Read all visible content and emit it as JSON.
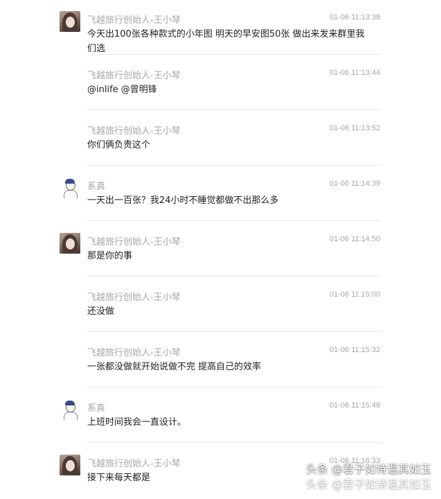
{
  "messages": [
    {
      "sender": "飞越旅行创始人-王小琴",
      "time": "01-06 11:13:38",
      "avatar": "female-photo",
      "text": "今天出100张各种款式的小年图 明天的早安图50张 做出来发来群里我们选",
      "show_avatar": true
    },
    {
      "sender": "飞越旅行创始人-王小琴",
      "time": "01-06 11:13:44",
      "avatar": "female-photo",
      "text": "@inlife @曾明锋",
      "show_avatar": false
    },
    {
      "sender": "飞越旅行创始人-王小琴",
      "time": "01-06 11:13:52",
      "avatar": "female-photo",
      "text": "你们俩负责这个",
      "show_avatar": false
    },
    {
      "sender": "系真",
      "time": "01-06 11:14:39",
      "avatar": "anime-sketch",
      "text": "一天出一百张？我24小时不睡觉都做不出那么多",
      "show_avatar": true
    },
    {
      "sender": "飞越旅行创始人-王小琴",
      "time": "01-06 11:14:50",
      "avatar": "female-photo",
      "text": "那是你的事",
      "show_avatar": true
    },
    {
      "sender": "飞越旅行创始人-王小琴",
      "time": "01-06 11:15:00",
      "avatar": "female-photo",
      "text": "还没做",
      "show_avatar": false
    },
    {
      "sender": "飞越旅行创始人-王小琴",
      "time": "01-06 11:15:32",
      "avatar": "female-photo",
      "text": "一张都没做就开始说做不完 提高自己的效率",
      "show_avatar": false
    },
    {
      "sender": "系真",
      "time": "01-06 11:15:48",
      "avatar": "anime-sketch",
      "text": "上班时间我会一直设计。",
      "show_avatar": true
    },
    {
      "sender": "飞越旅行创始人-王小琴",
      "time": "01-06 11:16:33",
      "avatar": "female-photo",
      "text": "接下来每天都是",
      "show_avatar": true
    }
  ],
  "watermark": {
    "line1": "头条 @君子如诗温其如玉",
    "line2": "头条 @君子如诗温其如玉"
  }
}
